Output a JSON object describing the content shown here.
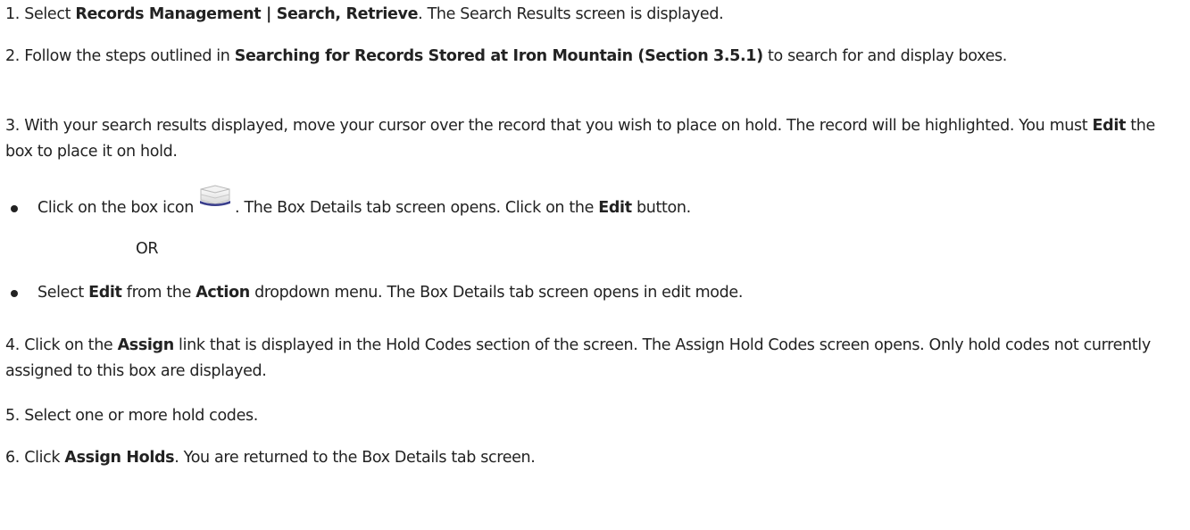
{
  "steps": {
    "s1": {
      "num": "1. Select ",
      "b1": "Records Management | Search, Retrieve",
      "t1": ". The Search Results screen is displayed."
    },
    "s2": {
      "num": "2. Follow the steps outlined in ",
      "b1": "Searching for Records Stored at Iron Mountain (Section 3.5.1)",
      "t1": " to search for and display boxes."
    },
    "s3": {
      "num": "3. With your search results displayed, move your cursor over the record that you wish to place on hold. The record will be highlighted. You must ",
      "b1": "Edit",
      "t1": " the box to place it on hold."
    },
    "bullet1": {
      "t0": "Click on the box icon",
      "icon": "box-icon",
      "t1": ". The Box Details tab screen opens. Click on the ",
      "b1": "Edit",
      "t2": " button."
    },
    "or": "OR",
    "bullet2": {
      "t0": "Select ",
      "b1": "Edit",
      "t1": " from the ",
      "b2": "Action",
      "t2": " dropdown menu. The Box Details tab screen opens in edit mode."
    },
    "s4": {
      "num": "4. Click on the ",
      "b1": "Assign",
      "t1": " link that is displayed in the Hold Codes section of the screen. The Assign Hold Codes screen opens. Only hold codes not currently assigned to this box are displayed."
    },
    "s5": {
      "text": "5. Select one or more hold codes."
    },
    "s6": {
      "num": "6. Click ",
      "b1": "Assign Holds",
      "t1": ". You are returned to the Box Details tab screen."
    }
  },
  "colors": {
    "text": "#222222",
    "icon_base": "#3b3f8c"
  }
}
